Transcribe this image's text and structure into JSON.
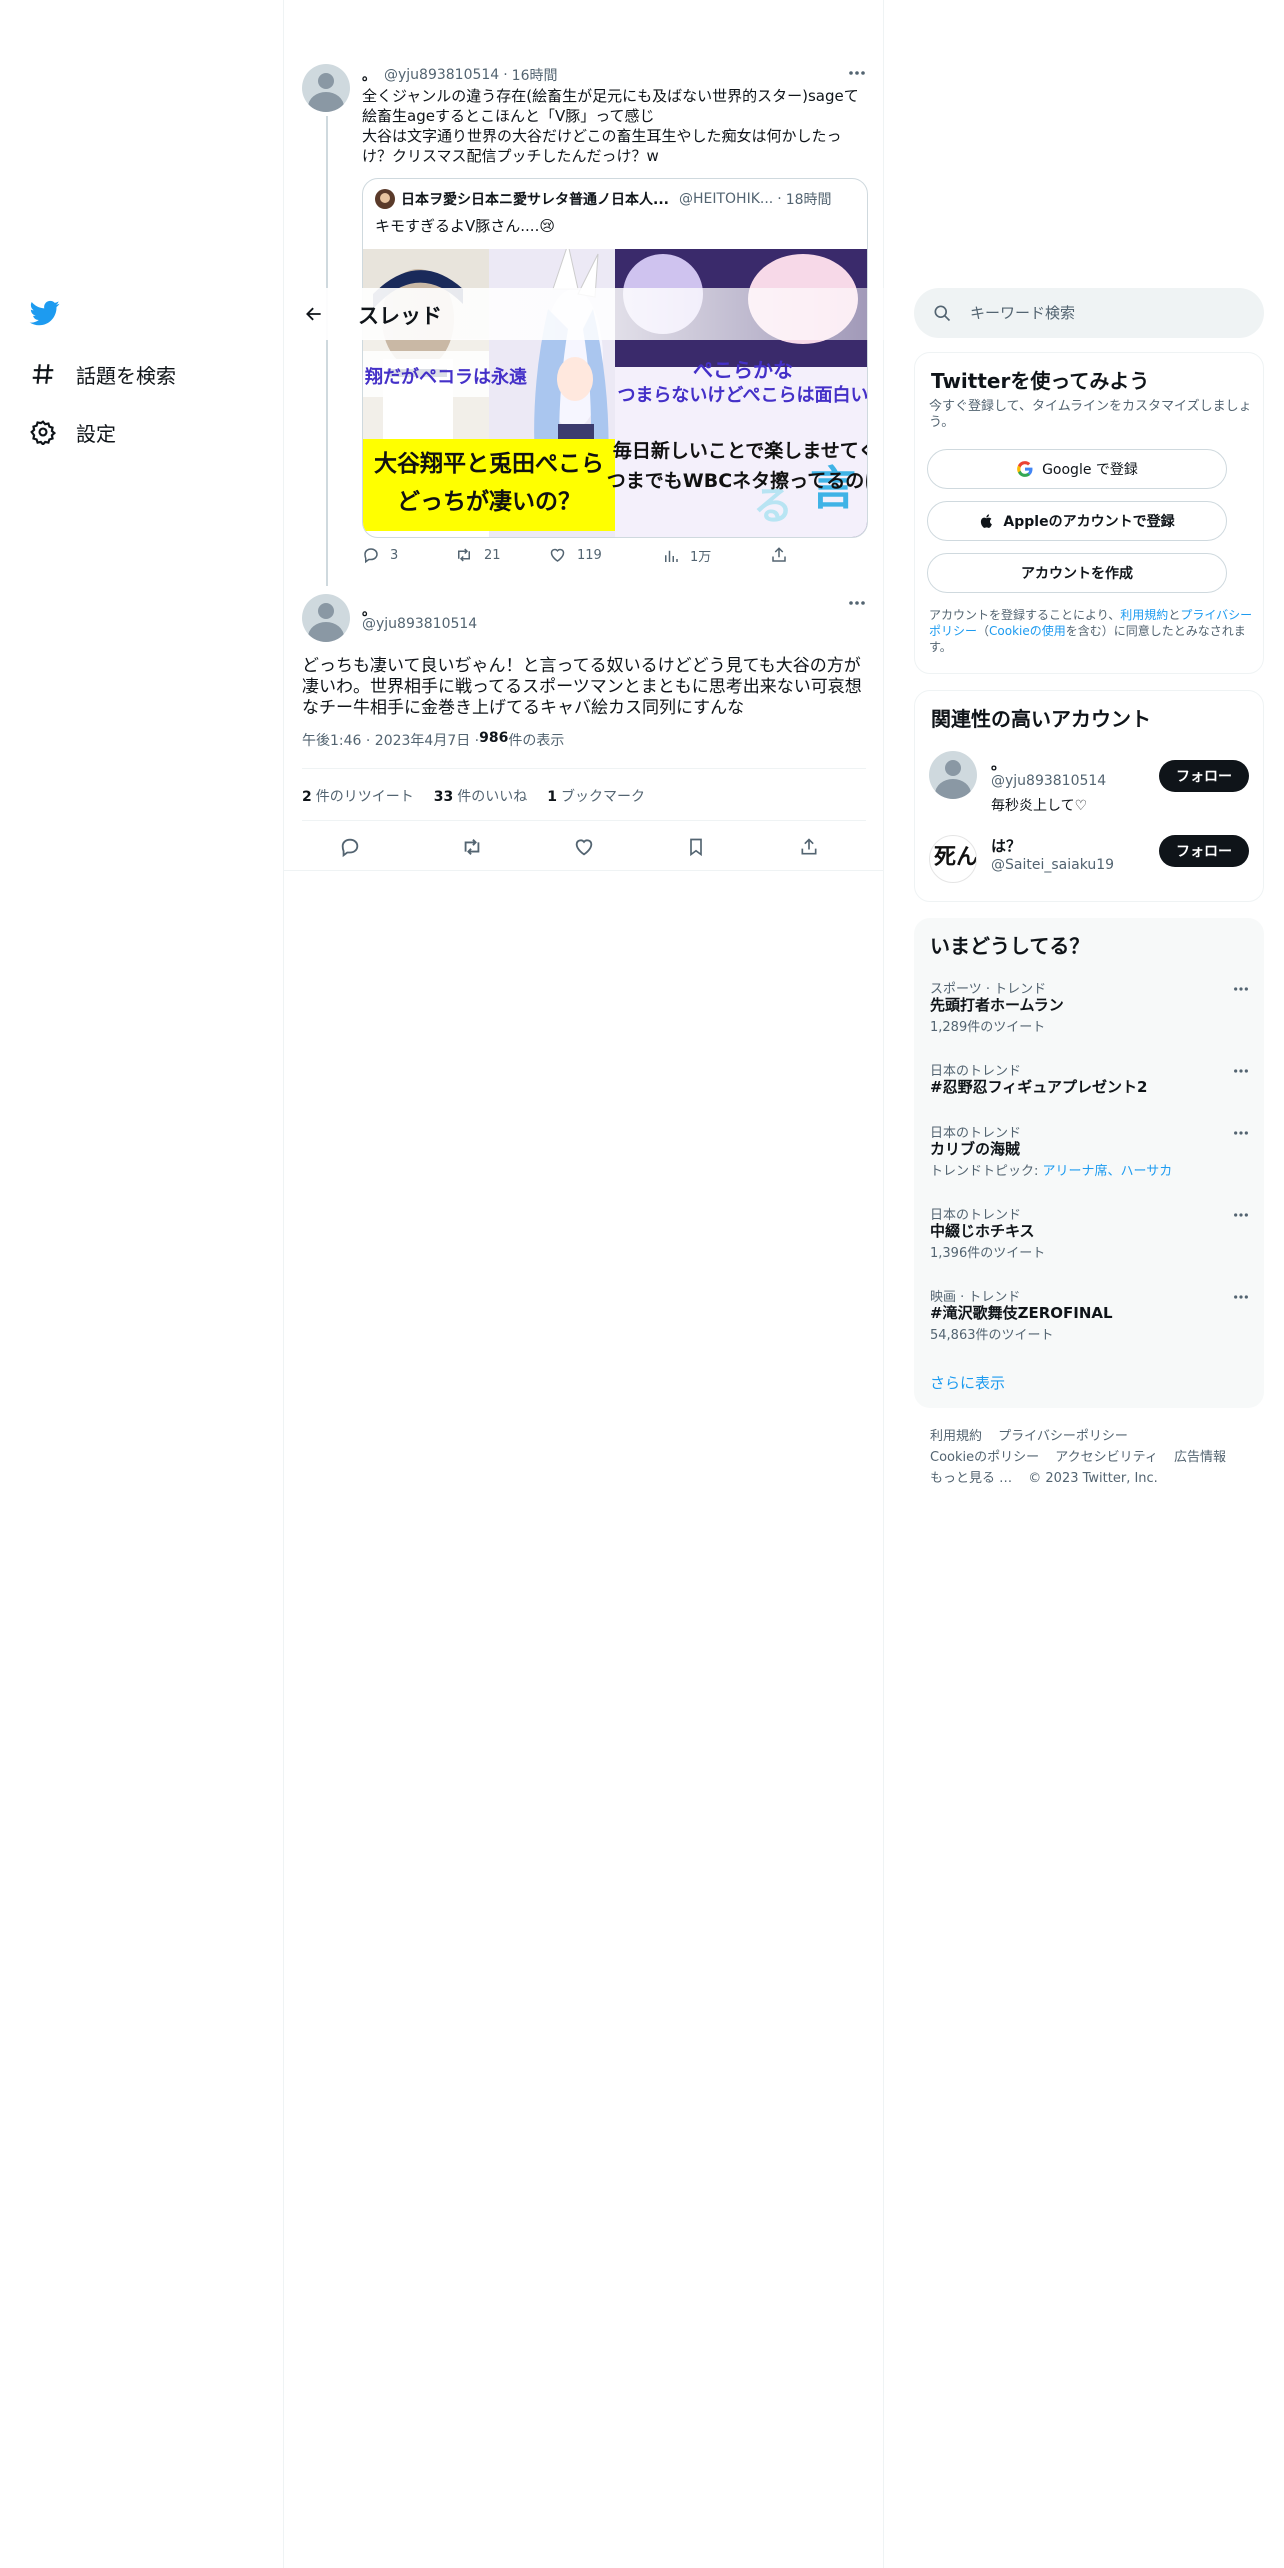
{
  "nav": {
    "items": [
      {
        "label": "話題を検索"
      },
      {
        "label": "設定"
      }
    ]
  },
  "header": {
    "title": "スレッド"
  },
  "tweet1": {
    "name": "。",
    "handle": "@yju893810514",
    "time": "16時間",
    "lines": [
      "全くジャンルの違う存在(絵畜生が足元にも及ばない世界的スター)sageて",
      "絵畜生ageするとこほんと「V豚」って感じ",
      "大谷は文字通り世界の大谷だけどこの畜生耳生やした痴女は何かしたっ",
      "け？クリスマス配信プッチしたんだっけ？w"
    ],
    "quote": {
      "name": "日本ヲ愛シ日本ニ愛サレタ普通ノ日本人...",
      "handle": "@HEITOHIK...",
      "time": "18時間",
      "text": "キモすぎるよV豚さん....😢",
      "media": {
        "left_caption_top": "翔だがペコラは永遠",
        "left_caption_main1": "大谷翔平と兎田ぺこら",
        "left_caption_main2": "どっちが凄いの？",
        "right_caption_top1": "ぺこらかな",
        "right_caption_top2": "つまらないけどぺこらは面白い",
        "right_caption_main1": "毎日新しいことで楽しませてく",
        "right_caption_main2": "つまでもWBCネタ擦ってるのは"
      }
    },
    "actions": {
      "replies": "3",
      "retweets": "21",
      "likes": "119",
      "views": "1万"
    }
  },
  "tweet2": {
    "name": "。",
    "handle": "@yju893810514",
    "lines": [
      "どっちも凄いて良いぢゃん！と言ってる奴いるけどどう見ても大谷の方が",
      "凄いわ。世界相手に戦ってるスポーツマンとまともに思考出来ない可哀想",
      "なチー牛相手に金巻き上げてるキャバ絵カス同列にすんな"
    ],
    "timestamp": "午後1:46 · 2023年4月7日 · ",
    "views_count": "986",
    "views_label": " 件の表示",
    "stats": [
      {
        "count": "2",
        "label": "件のリツイート"
      },
      {
        "count": "33",
        "label": "件のいいね"
      },
      {
        "count": "1",
        "label": "ブックマーク"
      }
    ]
  },
  "sidebar": {
    "search_placeholder": "キーワード検索",
    "signup": {
      "title": "Twitterを使ってみよう",
      "desc": "今すぐ登録して、タイムラインをカスタマイズしましょう。",
      "google_label": "Google で登録",
      "apple_label": "Appleのアカウントで登録",
      "create_label": "アカウントを作成",
      "legal_prefix": "アカウントを登録することにより、",
      "legal_link1": "利用規約",
      "legal_and": "と",
      "legal_link2": "プライバシーポリシー",
      "legal_paren_open": "（",
      "legal_link3": "Cookieの使用",
      "legal_suffix": "を含む）に同意したとみなされます。"
    },
    "related": {
      "title": "関連性の高いアカウント",
      "users": [
        {
          "name": "。",
          "handle": "@yju893810514",
          "bio": "毎秒炎上して♡",
          "follow": "フォロー"
        },
        {
          "name": "は？",
          "handle": "@Saitei_saiaku19",
          "bio": "",
          "follow": "フォロー",
          "avatar_text": "死んだ"
        }
      ]
    },
    "trends": {
      "title": "いまどうしてる？",
      "items": [
        {
          "category": "スポーツ · トレンド",
          "name": "先頭打者ホームラン",
          "sub": "1,289件のツイート"
        },
        {
          "category": "日本のトレンド",
          "name": "#忍野忍フィギュアプレゼント2",
          "sub": ""
        },
        {
          "category": "日本のトレンド",
          "name": "カリブの海賊",
          "sub_prefix": "トレンドトピック: ",
          "sub_link": "アリーナ席、ハーサカ"
        },
        {
          "category": "日本のトレンド",
          "name": "中綴じホチキス",
          "sub": "1,396件のツイート"
        },
        {
          "category": "映画 · トレンド",
          "name": "#滝沢歌舞伎ZEROFINAL",
          "sub": "54,863件のツイート"
        }
      ],
      "show_more": "さらに表示"
    },
    "footer": {
      "links": [
        "利用規約",
        "プライバシーポリシー",
        "Cookieのポリシー",
        "アクセシビリティ",
        "広告情報",
        "もっと見る …"
      ],
      "copyright": "© 2023 Twitter, Inc."
    }
  },
  "colors": {
    "accent": "#1d9bf0",
    "text": "#0f1419",
    "muted": "#536471",
    "border": "#eff3f4",
    "follow_bg": "#0f1419"
  }
}
